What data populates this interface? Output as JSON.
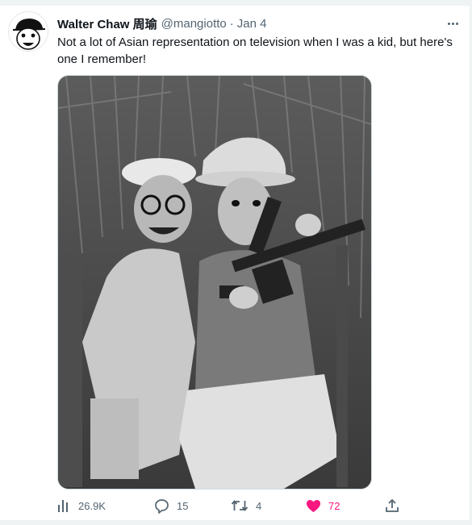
{
  "tweet": {
    "author_name": "Walter Chaw 周瑜",
    "handle": "@mangiotto",
    "separator": "·",
    "date": "Jan 4",
    "text": "Not a lot of Asian representation on television when I was a kid, but here's one I remember!"
  },
  "actions": {
    "views": "26.9K",
    "replies": "15",
    "retweets": "4",
    "likes": "72"
  },
  "colors": {
    "text_primary": "#0f1419",
    "text_secondary": "#536471",
    "like_active": "#f91880",
    "border": "#cfd9de"
  },
  "icons": {
    "more": "more-horizontal-icon",
    "views": "analytics-icon",
    "reply": "reply-icon",
    "retweet": "retweet-icon",
    "like": "heart-filled-icon",
    "share": "share-icon"
  }
}
